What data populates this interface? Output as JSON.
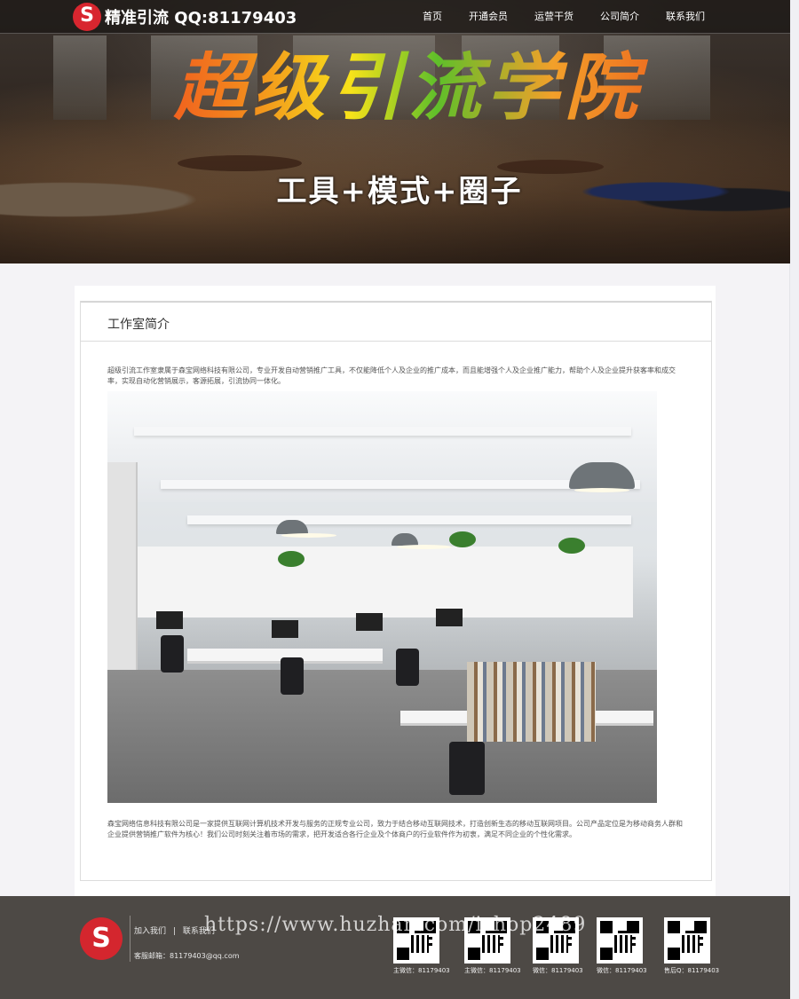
{
  "header": {
    "brand": "精准引流 QQ:81179403",
    "nav": [
      "首页",
      "开通会员",
      "运营干货",
      "公司简介",
      "联系我们"
    ]
  },
  "hero": {
    "title": "超级引流学院",
    "subtitle": "工具+模式+圈子"
  },
  "main": {
    "section_title": "工作室简介",
    "intro": "超级引流工作室隶属于森宝网络科技有限公司，专业开发自动营销推广工具，不仅能降低个人及企业的推广成本，而且能增强个人及企业推广能力，帮助个人及企业提升获客率和成交率，实现自动化营销展示，客源拓展，引流协同一体化。",
    "body": "森宝网络信息科技有限公司是一家提供互联网计算机技术开发与服务的正规专业公司，致力于结合移动互联网技术，打造创新生态的移动互联网项目。公司产品定位是为移动商务人群和企业提供营销推广软件为核心！我们公司时刻关注着市场的需求，把开发适合各行企业及个体商户的行业软件作为初衷，满足不同企业的个性化需求。"
  },
  "footer": {
    "links": [
      "加入我们",
      "|",
      "联系我们"
    ],
    "email": "客服邮箱：81179403@qq.com",
    "watermark": "https://www.huzhan.com/ishop2489",
    "qrcodes": [
      {
        "caption": "主微信：81179403"
      },
      {
        "caption": "主微信：81179403"
      },
      {
        "caption": "微信：81179403"
      },
      {
        "caption": "微信：81179403"
      },
      {
        "caption": "售后Q：81179403"
      }
    ]
  },
  "colors": {
    "topbar": "#1c1816",
    "footer": "#4d4945",
    "logo_red": "#d8262f",
    "page_bg": "#f4f3f6"
  }
}
